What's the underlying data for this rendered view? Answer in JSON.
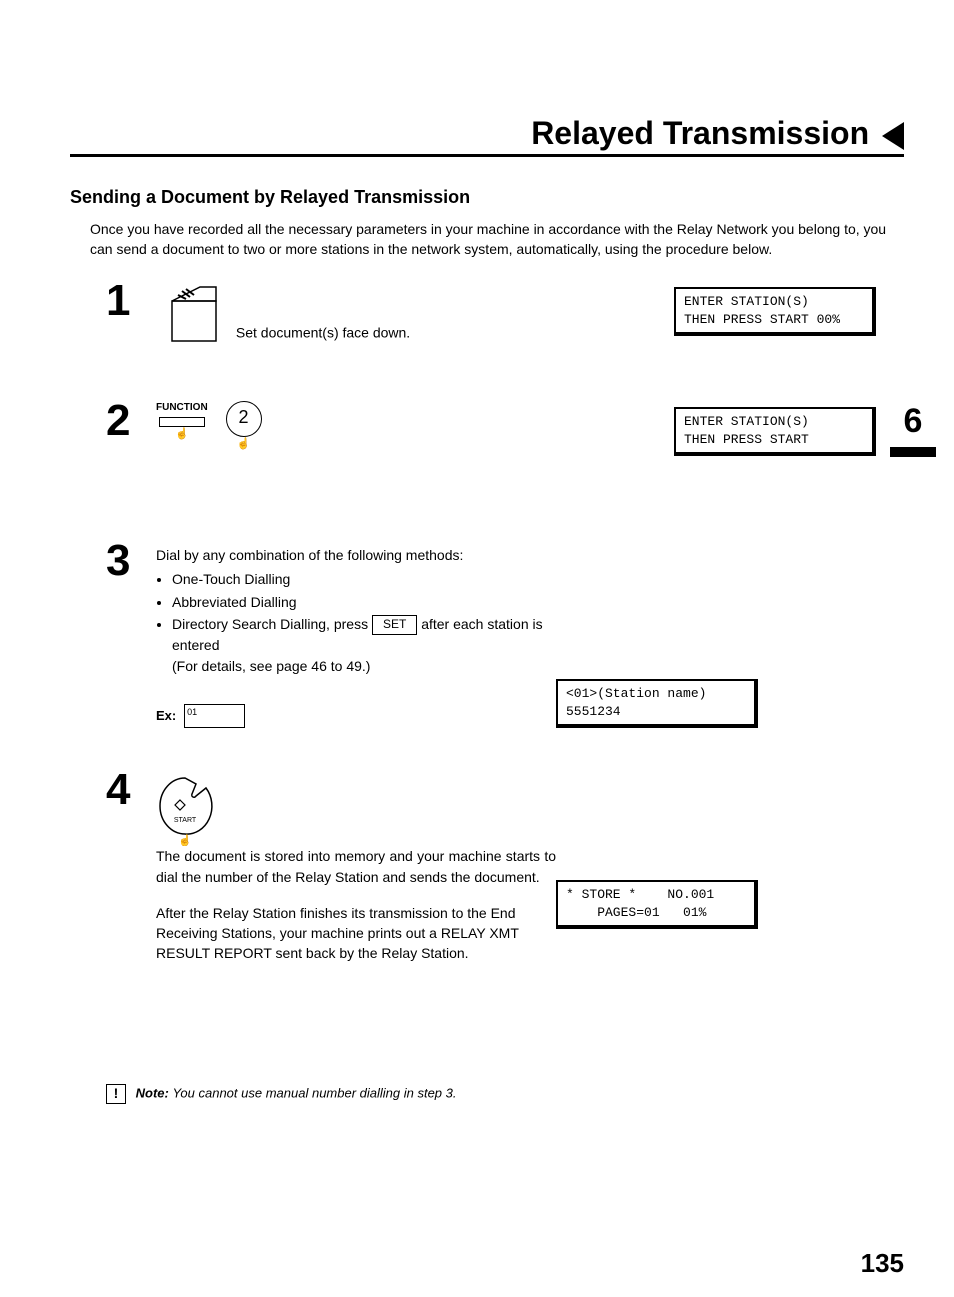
{
  "header": {
    "title": "Relayed Transmission"
  },
  "section_title": "Sending a Document by Relayed Transmission",
  "intro": "Once you have recorded all the necessary parameters in your machine in accordance with the Relay Network you belong to, you can send a document to two or more stations in the network system, automatically, using the procedure below.",
  "side_tab": "6",
  "steps": {
    "s1": {
      "num": "1",
      "text_after_icon": "Set document(s) face down.",
      "lcd": "ENTER STATION(S)\nTHEN PRESS START 00%"
    },
    "s2": {
      "num": "2",
      "function_label": "FUNCTION",
      "key_digit": "2",
      "lcd": "ENTER STATION(S)\nTHEN PRESS START"
    },
    "s3": {
      "num": "3",
      "lead": "Dial by any combination of the following methods:",
      "bullets": [
        "One-Touch Dialling",
        "Abbreviated Dialling"
      ],
      "bullet3_pre": "Directory Search Dialling, press ",
      "set_btn": "SET",
      "bullet3_post": " after each station is entered",
      "detail_line": "(For details, see page 46 to 49.)",
      "ex_label": "Ex:",
      "ex_box": "01",
      "lcd": "<01>(Station name)\n5551234"
    },
    "s4": {
      "num": "4",
      "start_label": "START",
      "para1": "The document is stored into memory and your machine starts to dial the number of the Relay Station and sends the document.",
      "para2": "After the Relay Station finishes its transmission to the End Receiving Stations, your machine prints out a RELAY XMT RESULT REPORT sent back by the Relay Station.",
      "lcd": "* STORE *    NO.001\n    PAGES=01   01%"
    }
  },
  "note": {
    "label": "Note:",
    "text": "You cannot use manual number dialling in step 3."
  },
  "page_number": "135"
}
